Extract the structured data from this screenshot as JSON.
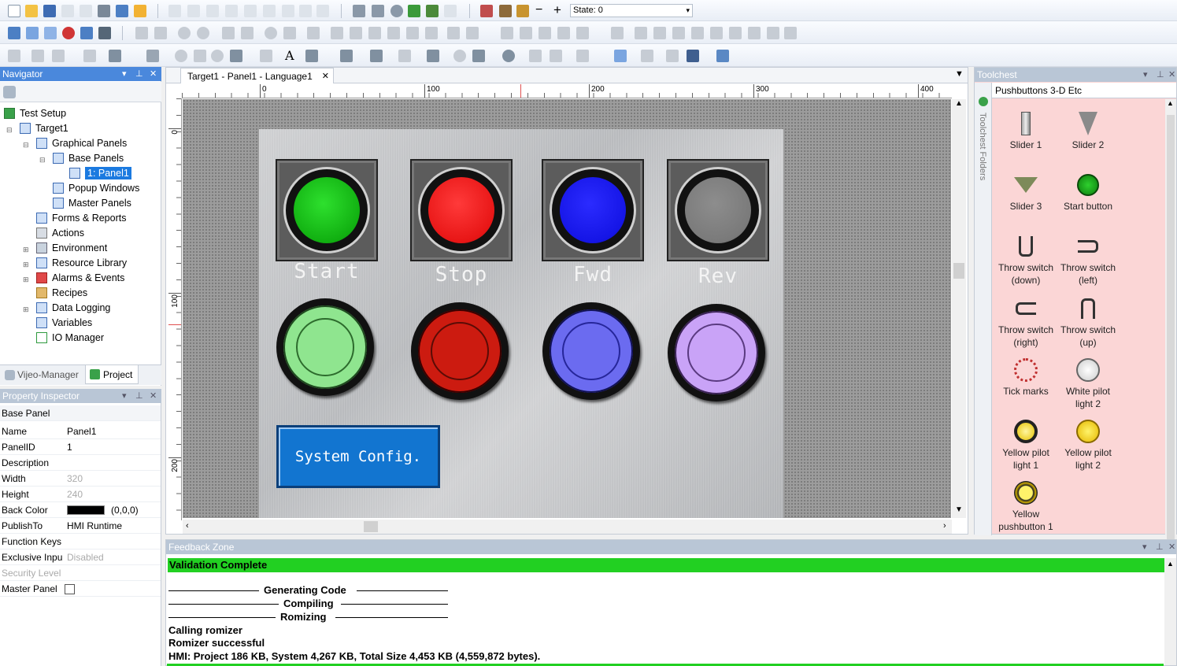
{
  "toolbar": {
    "state_label": "State: 0"
  },
  "navigator": {
    "title": "Navigator",
    "tree": [
      {
        "label": "Test Setup"
      },
      {
        "label": "Target1"
      },
      {
        "label": "Graphical Panels"
      },
      {
        "label": "Base Panels"
      },
      {
        "label": "1: Panel1"
      },
      {
        "label": "Popup Windows"
      },
      {
        "label": "Master Panels"
      },
      {
        "label": "Forms & Reports"
      },
      {
        "label": "Actions"
      },
      {
        "label": "Environment"
      },
      {
        "label": "Resource Library"
      },
      {
        "label": "Alarms & Events"
      },
      {
        "label": "Recipes"
      },
      {
        "label": "Data Logging"
      },
      {
        "label": "Variables"
      },
      {
        "label": "IO Manager"
      }
    ],
    "tabs": [
      "Vijeo-Manager",
      "Project"
    ]
  },
  "property_inspector": {
    "title": "Property Inspector",
    "header": "Base Panel",
    "rows": [
      {
        "key": "Name",
        "value": "Panel1"
      },
      {
        "key": "PanelID",
        "value": "1"
      },
      {
        "key": "Description",
        "value": ""
      },
      {
        "key": "Width",
        "value": "320"
      },
      {
        "key": "Height",
        "value": "240"
      },
      {
        "key": "Back Color",
        "value": "(0,0,0)"
      },
      {
        "key": "PublishTo",
        "value": "HMI Runtime"
      },
      {
        "key": "Function Keys",
        "value": ""
      },
      {
        "key": "Exclusive Inpu",
        "value": "Disabled"
      },
      {
        "key": "Security Level",
        "value": ""
      },
      {
        "key": "Master Panel",
        "value": ""
      }
    ]
  },
  "editor": {
    "tab_title": "Target1 - Panel1 - Language1",
    "ruler_h": [
      "0",
      "100",
      "200",
      "300",
      "400"
    ],
    "ruler_v": [
      "0",
      "100",
      "200"
    ],
    "buttons": [
      {
        "label": "Start",
        "color": "#1ecb1e"
      },
      {
        "label": "Stop",
        "color": "#f01d1d"
      },
      {
        "label": "Fwd",
        "color": "#1515e6"
      },
      {
        "label": "Rev",
        "color": "#7d7d7d"
      }
    ],
    "pilots": [
      {
        "name": "green",
        "color": "#8fe58f"
      },
      {
        "name": "red",
        "color": "#cc1b10"
      },
      {
        "name": "blue",
        "color": "#6b6bf0"
      },
      {
        "name": "violet",
        "color": "#c9a3f7"
      }
    ],
    "config_button": "System Config."
  },
  "toolchest": {
    "title": "Toolchest",
    "folder": "Pushbuttons 3-D Etc",
    "side_label": "Toolchest Folders",
    "items": [
      {
        "label": "Slider 1"
      },
      {
        "label": "Slider 2"
      },
      {
        "label": "Slider 3"
      },
      {
        "label": "Start button"
      },
      {
        "label": "Throw switch (down)"
      },
      {
        "label": "Throw switch (left)"
      },
      {
        "label": "Throw switch (right)"
      },
      {
        "label": "Throw switch (up)"
      },
      {
        "label": "Tick marks"
      },
      {
        "label": "White pilot light 2"
      },
      {
        "label": "Yellow pilot light 1"
      },
      {
        "label": "Yellow pilot light 2"
      },
      {
        "label": "Yellow pushbutton 1"
      }
    ]
  },
  "feedback": {
    "title": "Feedback Zone",
    "status": "Validation Complete",
    "lines": [
      "Generating Code",
      "Compiling",
      "Romizing",
      "Calling romizer",
      "Romizer successful",
      "HMI: Project 186 KB, System 4,267 KB, Total Size 4,453 KB (4,559,872 bytes)."
    ]
  }
}
